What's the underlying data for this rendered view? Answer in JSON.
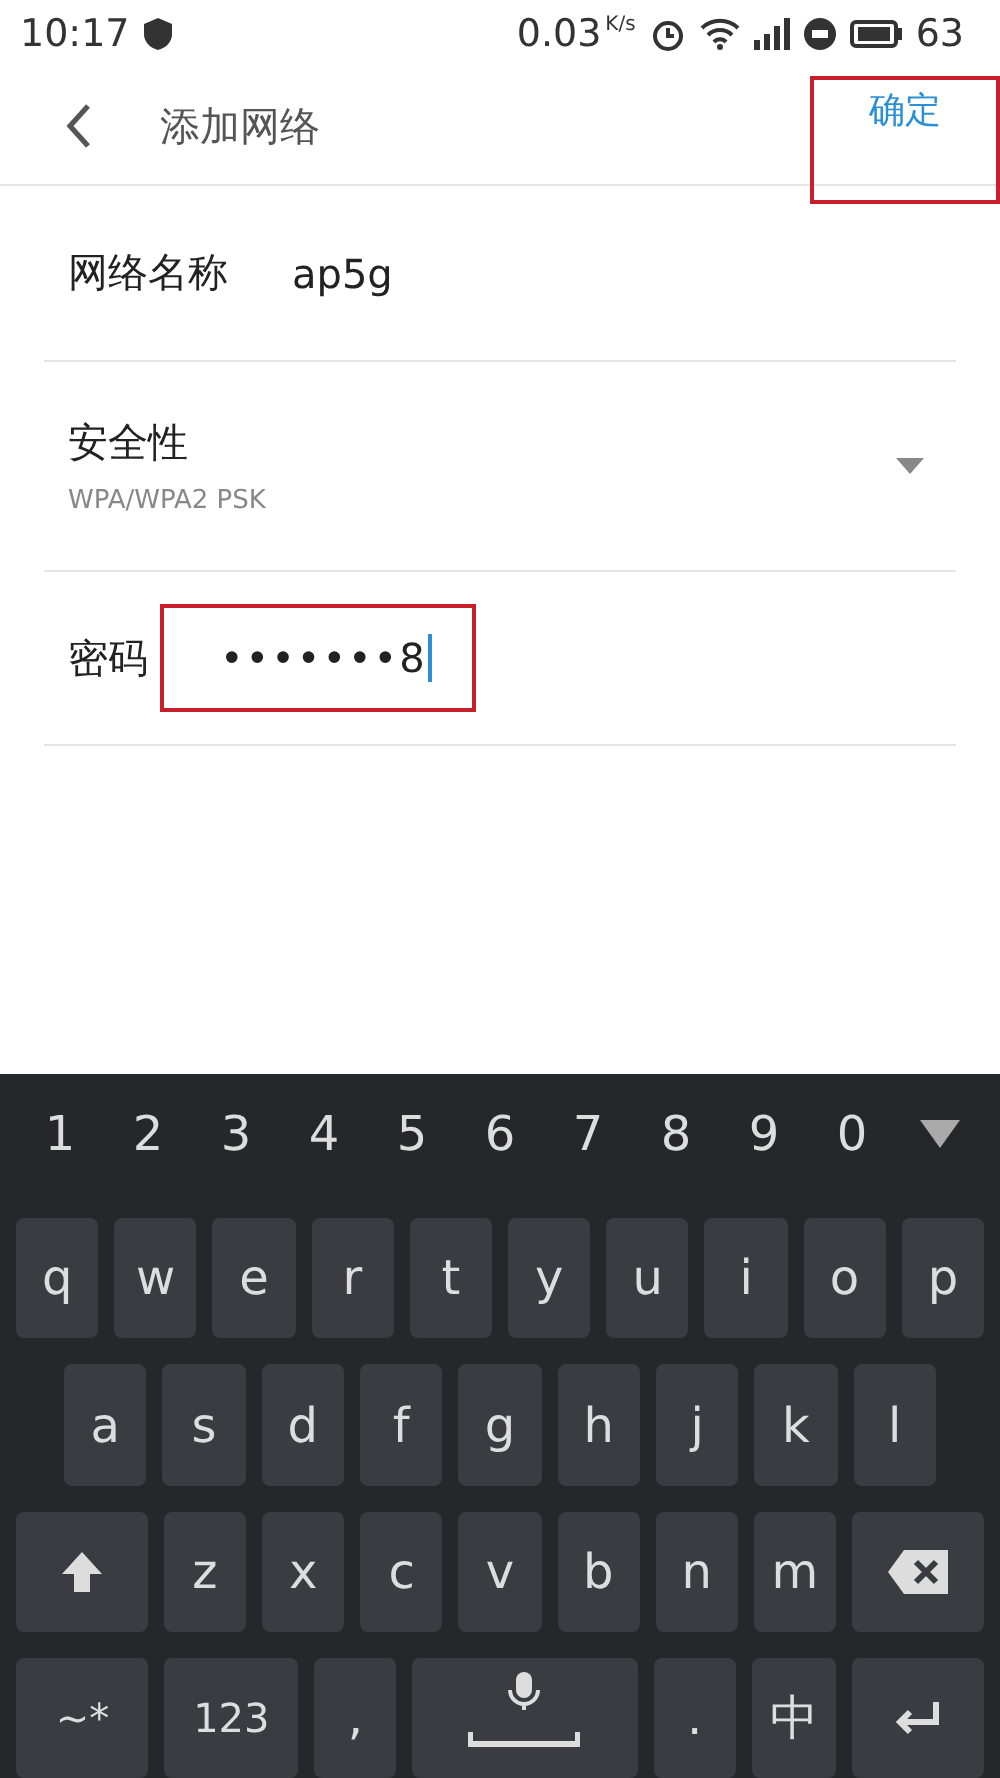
{
  "status_bar": {
    "time": "10:17",
    "speed": "0.03",
    "speed_unit": "K/s",
    "battery": "63"
  },
  "header": {
    "title": "添加网络",
    "confirm": {
      "label": "确定",
      "highlighted": true
    }
  },
  "form": [
    {
      "kind": "text",
      "label": "网络名称",
      "value": "ap5g"
    },
    {
      "kind": "select",
      "label": "安全性",
      "value": "WPA/WPA2 PSK"
    },
    {
      "kind": "password",
      "label": "密码",
      "value": "•••••••8",
      "focused": true,
      "highlighted": true
    }
  ],
  "keyboard": {
    "numbers": [
      "1",
      "2",
      "3",
      "4",
      "5",
      "6",
      "7",
      "8",
      "9",
      "0"
    ],
    "rows": [
      [
        {
          "kind": "letter",
          "label": "q"
        },
        {
          "kind": "letter",
          "label": "w"
        },
        {
          "kind": "letter",
          "label": "e"
        },
        {
          "kind": "letter",
          "label": "r"
        },
        {
          "kind": "letter",
          "label": "t"
        },
        {
          "kind": "letter",
          "label": "y"
        },
        {
          "kind": "letter",
          "label": "u"
        },
        {
          "kind": "letter",
          "label": "i"
        },
        {
          "kind": "letter",
          "label": "o"
        },
        {
          "kind": "letter",
          "label": "p"
        }
      ],
      [
        {
          "kind": "letter",
          "label": "a"
        },
        {
          "kind": "letter",
          "label": "s"
        },
        {
          "kind": "letter",
          "label": "d"
        },
        {
          "kind": "letter",
          "label": "f"
        },
        {
          "kind": "letter",
          "label": "g"
        },
        {
          "kind": "letter",
          "label": "h"
        },
        {
          "kind": "letter",
          "label": "j"
        },
        {
          "kind": "letter",
          "label": "k"
        },
        {
          "kind": "letter",
          "label": "l"
        }
      ],
      [
        {
          "kind": "shift"
        },
        {
          "kind": "letter",
          "label": "z"
        },
        {
          "kind": "letter",
          "label": "x"
        },
        {
          "kind": "letter",
          "label": "c"
        },
        {
          "kind": "letter",
          "label": "v"
        },
        {
          "kind": "letter",
          "label": "b"
        },
        {
          "kind": "letter",
          "label": "n"
        },
        {
          "kind": "letter",
          "label": "m"
        },
        {
          "kind": "backspace"
        }
      ]
    ],
    "bottom_row": [
      {
        "kind": "wide",
        "label": "~*"
      },
      {
        "kind": "wide",
        "label": "123"
      },
      {
        "kind": "letter",
        "label": ","
      },
      {
        "kind": "space"
      },
      {
        "kind": "letter",
        "label": "."
      },
      {
        "kind": "letter",
        "label": "中"
      },
      {
        "kind": "enter"
      }
    ]
  }
}
